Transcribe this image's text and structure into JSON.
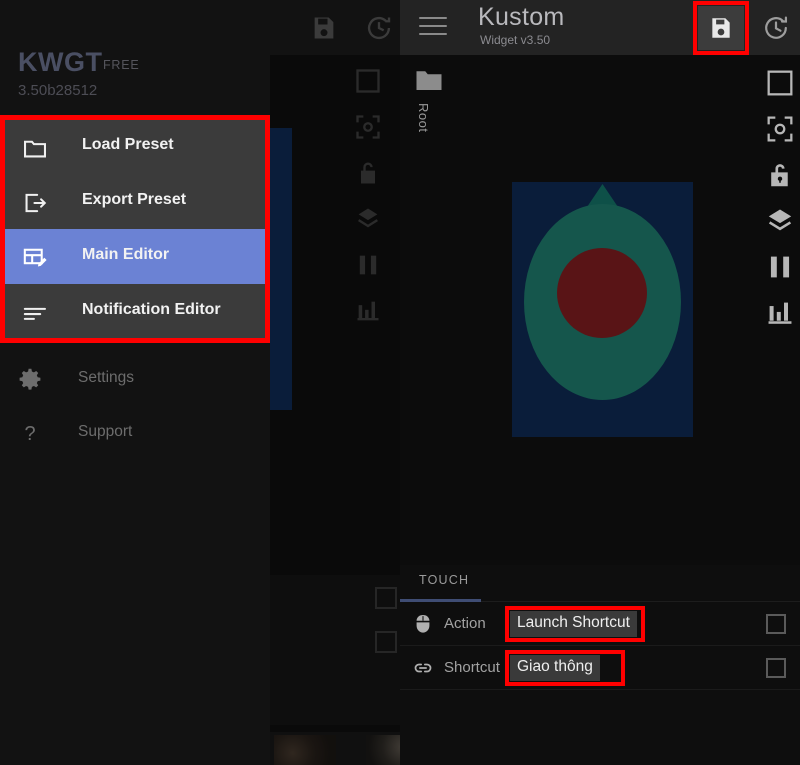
{
  "drawer": {
    "brand": "KWGT",
    "brand_tag": "FREE",
    "version": "3.50b28512",
    "highlight_color": "#ff0000",
    "accent_color": "#6b82d4",
    "menu_items": [
      {
        "label": "Load Preset",
        "icon": "folder-icon",
        "active": false
      },
      {
        "label": "Export Preset",
        "icon": "export-icon",
        "active": false
      },
      {
        "label": "Main Editor",
        "icon": "grid-edit-icon",
        "active": true
      },
      {
        "label": "Notification Editor",
        "icon": "notification-lines-icon",
        "active": false
      }
    ],
    "footer_items": [
      {
        "label": "Settings",
        "icon": "gear-icon"
      },
      {
        "label": "Support",
        "icon": "question-mark-icon"
      }
    ]
  },
  "topbar": {
    "title": "Kustom",
    "subtitle": "Widget v3.50",
    "menu_icon": "hamburger-icon",
    "save_icon": "save-floppy-icon",
    "history_icon": "history-clock-icon"
  },
  "editor": {
    "breadcrumb_label": "Root",
    "breadcrumb_icon": "folder-icon",
    "preview": {
      "background_color": "#0a1d3a",
      "ring_color": "#15564c",
      "center_color": "#591416",
      "tab_color": "#0e5048"
    },
    "rail_icons": [
      "background-square-icon",
      "camera-focus-icon",
      "unlock-icon",
      "layers-icon",
      "pause-icon",
      "bars-chart-icon"
    ]
  },
  "touch_panel": {
    "tab_label": "TOUCH",
    "tab_underline_color": "#3f4d74",
    "rows": [
      {
        "label": "Action",
        "icon": "mouse-icon",
        "value": "Launch Shortcut",
        "highlighted": true,
        "checkbox": false
      },
      {
        "label": "Shortcut",
        "icon": "link-chain-icon",
        "value": "Giao thông",
        "highlighted": true,
        "checkbox": false
      }
    ]
  }
}
